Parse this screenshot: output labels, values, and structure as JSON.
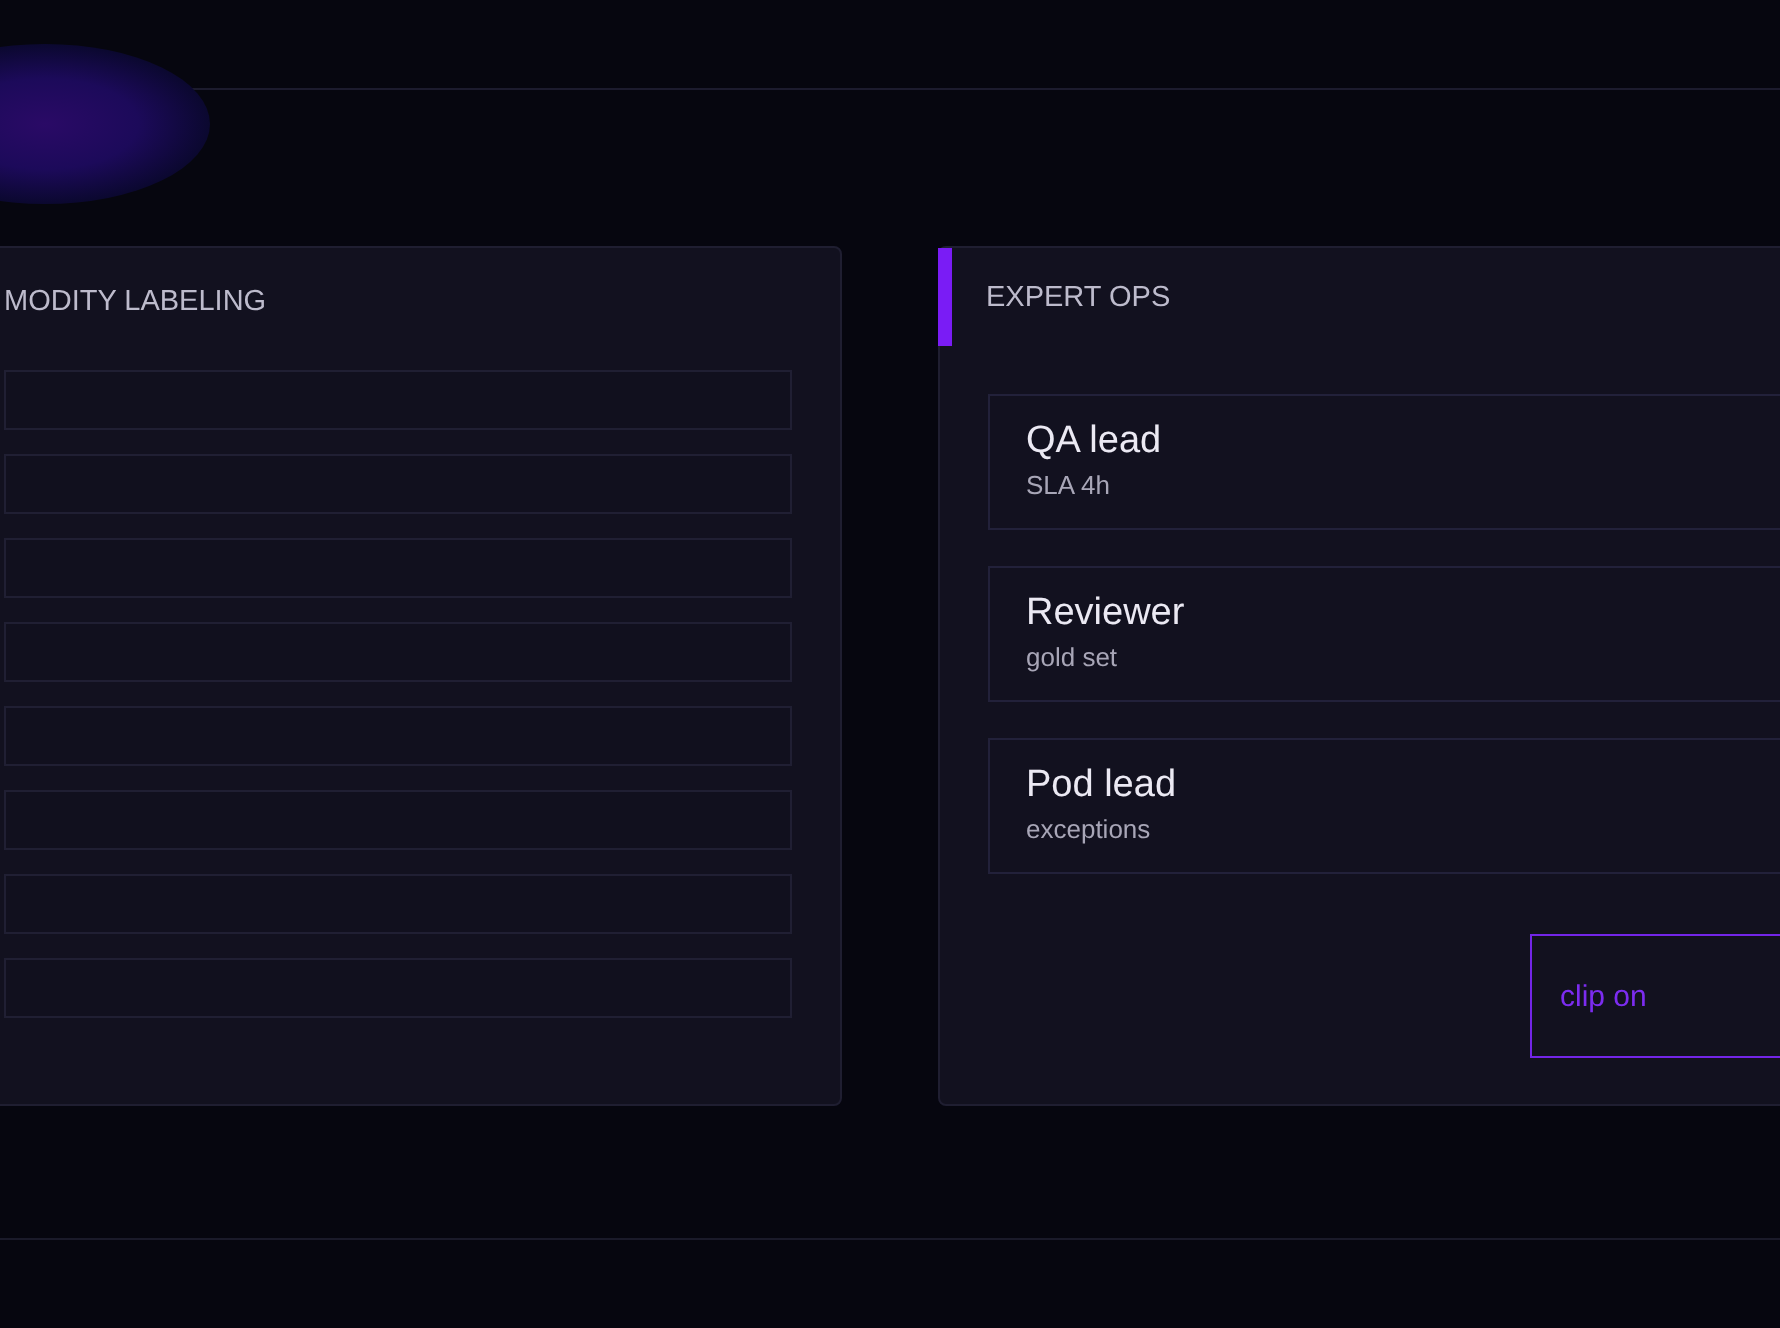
{
  "left_panel": {
    "title": "MODITY LABELING",
    "slots": [
      {
        "kind": "blank"
      },
      {
        "kind": "blank"
      },
      {
        "kind": "blank"
      },
      {
        "kind": "blank"
      },
      {
        "kind": "blank"
      },
      {
        "kind": "blank"
      },
      {
        "kind": "blank"
      },
      {
        "kind": "blank"
      }
    ]
  },
  "right_panel": {
    "title": "EXPERT OPS",
    "accent": true,
    "cards": [
      {
        "title": "QA lead",
        "subtitle": "SLA 4h"
      },
      {
        "title": "Reviewer",
        "subtitle": "gold set"
      },
      {
        "title": "Pod lead",
        "subtitle": "exceptions"
      }
    ],
    "button": {
      "label": "clip on"
    }
  }
}
